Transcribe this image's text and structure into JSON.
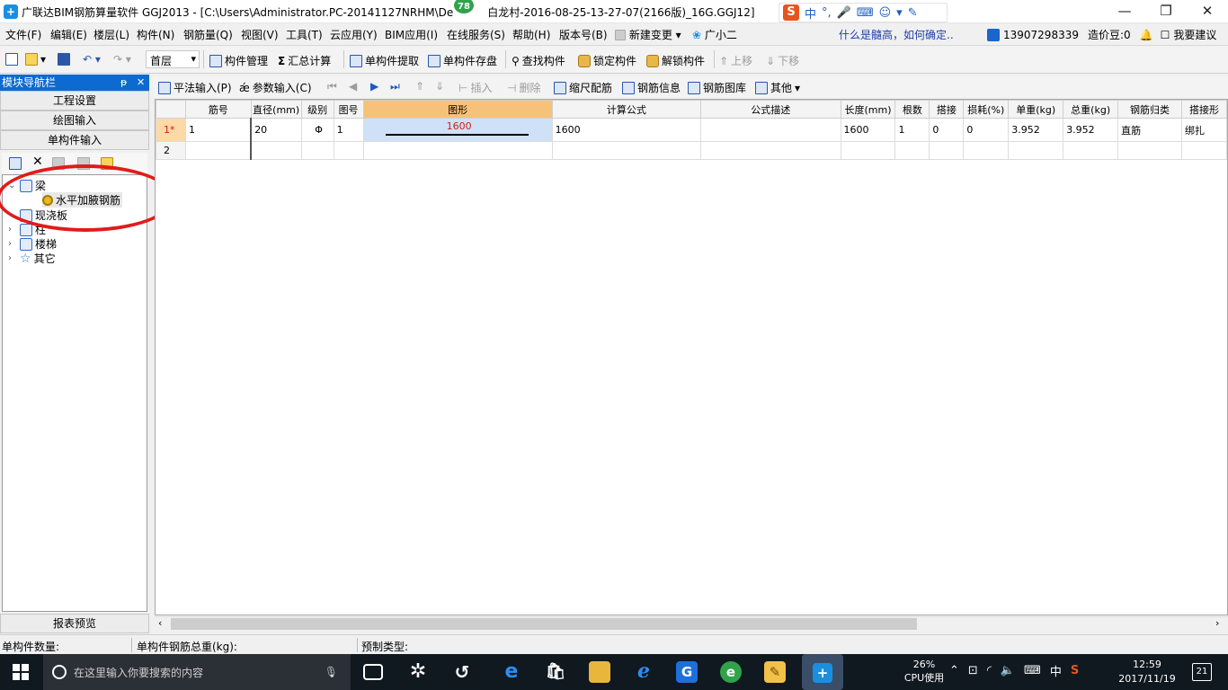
{
  "window": {
    "title": "广联达BIM钢筋算量软件 GGJ2013 - [C:\\Users\\Administrator.PC-20141127NRHM\\De",
    "title_suffix": "白龙村-2016-08-25-13-27-07(2166版)_16G.GGJ12]",
    "badge_count": "78",
    "controls": {
      "minimize": "—",
      "restore": "❐",
      "close": "✕"
    }
  },
  "ime": {
    "logo": "S",
    "mode": "中",
    "punct": "°,"
  },
  "menu": {
    "items": [
      "文件(F)",
      "编辑(E)",
      "楼层(L)",
      "构件(N)",
      "钢筋量(Q)",
      "视图(V)",
      "工具(T)",
      "云应用(Y)",
      "BIM应用(I)",
      "在线服务(S)",
      "帮助(H)",
      "版本号(B)",
      "新建变更",
      "广小二"
    ],
    "question": "什么是髓高，如何确定..",
    "phone": "13907298339",
    "price": "造价豆:0",
    "suggest": "我要建议"
  },
  "toolbar1": {
    "floor": "首层",
    "component_manage": "构件管理",
    "sum_calc": "汇总计算",
    "extract": "单构件提取",
    "save_disk": "单构件存盘",
    "find": "查找构件",
    "lock": "锁定构件",
    "unlock": "解锁构件",
    "move_up": "上移",
    "move_down": "下移"
  },
  "nav": {
    "title": "模块导航栏",
    "pin": "ᵽ",
    "close": "✕",
    "buttons": [
      "工程设置",
      "绘图输入",
      "单构件输入"
    ],
    "tree": [
      {
        "label": "梁",
        "expanded": true
      },
      {
        "label": "水平加腋钢筋",
        "selected": true
      },
      {
        "label": "现浇板"
      },
      {
        "label": "柱"
      },
      {
        "label": "楼梯"
      },
      {
        "label": "其它"
      }
    ],
    "report": "报表预览"
  },
  "toolbar2": {
    "flat_input": "平法输入(P)",
    "param_input": "参数输入(C)",
    "insert": "插入",
    "delete": "删除",
    "scale_rebar": "缩尺配筋",
    "rebar_info": "钢筋信息",
    "rebar_lib": "钢筋图库",
    "other": "其他"
  },
  "grid": {
    "columns": [
      "筋号",
      "直径(mm)",
      "级别",
      "图号",
      "图形",
      "计算公式",
      "公式描述",
      "长度(mm)",
      "根数",
      "搭接",
      "损耗(%)",
      "单重(kg)",
      "总重(kg)",
      "钢筋归类",
      "搭接形"
    ],
    "rows": [
      {
        "hdr": "1*",
        "cells": [
          "1",
          "20",
          "Φ",
          "1",
          "1600",
          "1600",
          "",
          "1600",
          "1",
          "0",
          "0",
          "3.952",
          "3.952",
          "直筋",
          "绑扎"
        ]
      },
      {
        "hdr": "2",
        "cells": [
          "",
          "",
          "",
          "",
          "",
          "",
          "",
          "",
          "",
          "",
          "",
          "",
          "",
          "",
          ""
        ]
      }
    ]
  },
  "status": {
    "count_label": "单构件数量:",
    "weight_label": "单构件钢筋总重(kg):",
    "type_label": "预制类型:"
  },
  "taskbar": {
    "search_placeholder": "在这里输入你要搜索的内容",
    "cpu_pct": "26%",
    "cpu_label": "CPU使用",
    "lang": "中",
    "time": "12:59",
    "date": "2017/11/19",
    "notif": "21"
  }
}
